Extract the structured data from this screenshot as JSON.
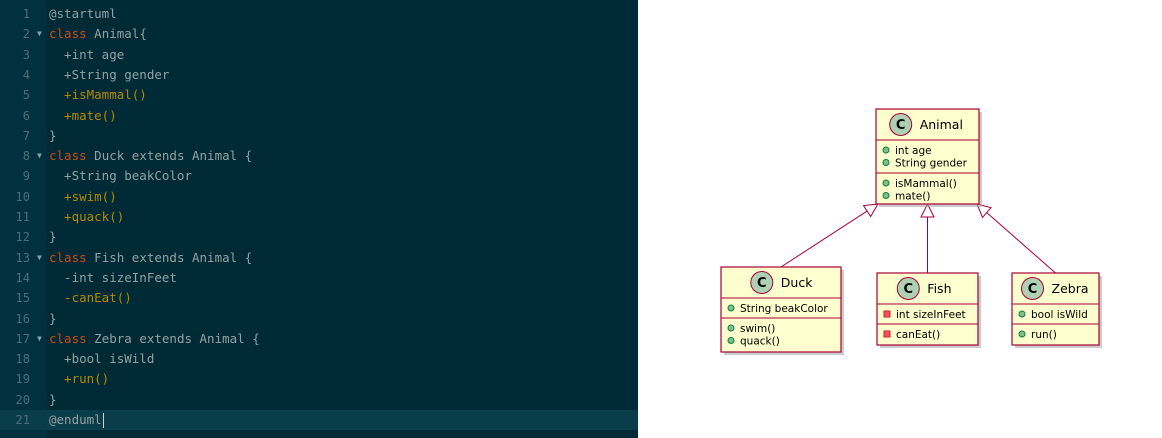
{
  "editor": {
    "lines": [
      {
        "n": "1",
        "fold": false,
        "tokens": [
          {
            "t": "@startuml",
            "k": "plain"
          }
        ]
      },
      {
        "n": "2",
        "fold": true,
        "tokens": [
          {
            "t": "class",
            "k": "kw"
          },
          {
            "t": " Animal{",
            "k": "plain"
          }
        ]
      },
      {
        "n": "3",
        "fold": false,
        "tokens": [
          {
            "t": "  +int age",
            "k": "plain"
          }
        ]
      },
      {
        "n": "4",
        "fold": false,
        "tokens": [
          {
            "t": "  +String gender",
            "k": "plain"
          }
        ]
      },
      {
        "n": "5",
        "fold": false,
        "tokens": [
          {
            "t": "  +isMammal()",
            "k": "method"
          }
        ]
      },
      {
        "n": "6",
        "fold": false,
        "tokens": [
          {
            "t": "  +mate()",
            "k": "method"
          }
        ]
      },
      {
        "n": "7",
        "fold": false,
        "tokens": [
          {
            "t": "}",
            "k": "plain"
          }
        ]
      },
      {
        "n": "8",
        "fold": true,
        "tokens": [
          {
            "t": "class",
            "k": "kw"
          },
          {
            "t": " Duck extends Animal {",
            "k": "plain"
          }
        ]
      },
      {
        "n": "9",
        "fold": false,
        "tokens": [
          {
            "t": "  +String beakColor",
            "k": "plain"
          }
        ]
      },
      {
        "n": "10",
        "fold": false,
        "tokens": [
          {
            "t": "  +swim()",
            "k": "method"
          }
        ]
      },
      {
        "n": "11",
        "fold": false,
        "tokens": [
          {
            "t": "  +quack()",
            "k": "method"
          }
        ]
      },
      {
        "n": "12",
        "fold": false,
        "tokens": [
          {
            "t": "}",
            "k": "plain"
          }
        ]
      },
      {
        "n": "13",
        "fold": true,
        "tokens": [
          {
            "t": "class",
            "k": "kw"
          },
          {
            "t": " Fish extends Animal {",
            "k": "plain"
          }
        ]
      },
      {
        "n": "14",
        "fold": false,
        "tokens": [
          {
            "t": "  -int sizeInFeet",
            "k": "plain"
          }
        ]
      },
      {
        "n": "15",
        "fold": false,
        "tokens": [
          {
            "t": "  -canEat()",
            "k": "method"
          }
        ]
      },
      {
        "n": "16",
        "fold": false,
        "tokens": [
          {
            "t": "}",
            "k": "plain"
          }
        ]
      },
      {
        "n": "17",
        "fold": true,
        "tokens": [
          {
            "t": "class",
            "k": "kw"
          },
          {
            "t": " Zebra extends Animal {",
            "k": "plain"
          }
        ]
      },
      {
        "n": "18",
        "fold": false,
        "tokens": [
          {
            "t": "  +bool isWild",
            "k": "plain"
          }
        ]
      },
      {
        "n": "19",
        "fold": false,
        "tokens": [
          {
            "t": "  +run()",
            "k": "method"
          }
        ]
      },
      {
        "n": "20",
        "fold": false,
        "tokens": [
          {
            "t": "}",
            "k": "plain"
          }
        ]
      },
      {
        "n": "21",
        "fold": false,
        "active": true,
        "tokens": [
          {
            "t": "@enduml",
            "k": "plain"
          }
        ]
      }
    ]
  },
  "diagram": {
    "classes": {
      "animal": {
        "name": "Animal",
        "stereotype_glyph": "C",
        "fields": [
          {
            "vis": "public",
            "text": "int age"
          },
          {
            "vis": "public",
            "text": "String gender"
          }
        ],
        "methods": [
          {
            "vis": "public",
            "text": "isMammal()"
          },
          {
            "vis": "public",
            "text": "mate()"
          }
        ]
      },
      "duck": {
        "name": "Duck",
        "stereotype_glyph": "C",
        "fields": [
          {
            "vis": "public",
            "text": "String beakColor"
          }
        ],
        "methods": [
          {
            "vis": "public",
            "text": "swim()"
          },
          {
            "vis": "public",
            "text": "quack()"
          }
        ]
      },
      "fish": {
        "name": "Fish",
        "stereotype_glyph": "C",
        "fields": [
          {
            "vis": "private",
            "text": "int sizeInFeet"
          }
        ],
        "methods": [
          {
            "vis": "private",
            "text": "canEat()"
          }
        ]
      },
      "zebra": {
        "name": "Zebra",
        "stereotype_glyph": "C",
        "fields": [
          {
            "vis": "public",
            "text": "bool isWild"
          }
        ],
        "methods": [
          {
            "vis": "public",
            "text": "run()"
          }
        ]
      }
    },
    "relations": [
      {
        "from": "duck",
        "to": "animal",
        "type": "extends"
      },
      {
        "from": "fish",
        "to": "animal",
        "type": "extends"
      },
      {
        "from": "zebra",
        "to": "animal",
        "type": "extends"
      }
    ],
    "colors": {
      "class_fill": "#fefece",
      "class_border": "#a80036",
      "glyph_fill": "#add1b2",
      "public_fill": "#84be84",
      "public_stroke": "#038048",
      "private_fill": "#f24d5c",
      "private_stroke": "#c82930"
    }
  }
}
